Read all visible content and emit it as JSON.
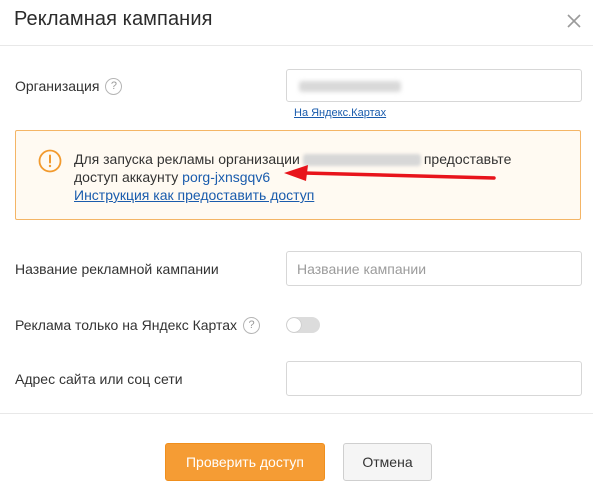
{
  "modal": {
    "title": "Рекламная кампания"
  },
  "form": {
    "organization": {
      "label": "Организация",
      "value_hidden": "CyberMarketing",
      "maps_link": "На Яндекс.Картах"
    },
    "warning": {
      "line1_prefix": "Для запуска рекламы организации",
      "org_hidden": "CyberMarketing",
      "line1_suffix": "предоставьте",
      "line2_prefix": "доступ аккаунту",
      "account": "porg-jxnsgqv6",
      "howto_link": "Инструкция как предоставить доступ"
    },
    "campaign_name": {
      "label": "Название рекламной кампании",
      "placeholder": "Название кампании",
      "value": ""
    },
    "maps_only": {
      "label": "Реклама только на Яндекс Картах",
      "enabled": false
    },
    "website": {
      "label": "Адрес сайта или соц сети",
      "value": ""
    }
  },
  "buttons": {
    "check_access": "Проверить доступ",
    "cancel": "Отмена"
  },
  "colors": {
    "primary": "#f59c34",
    "link": "#1a5cad",
    "warning_border": "#f4b566",
    "warning_bg": "#fffaf2",
    "arrow": "#e8141c"
  },
  "icons": {
    "close": "close-icon",
    "help": "help-circle-icon",
    "warning": "exclamation-circle-icon"
  }
}
